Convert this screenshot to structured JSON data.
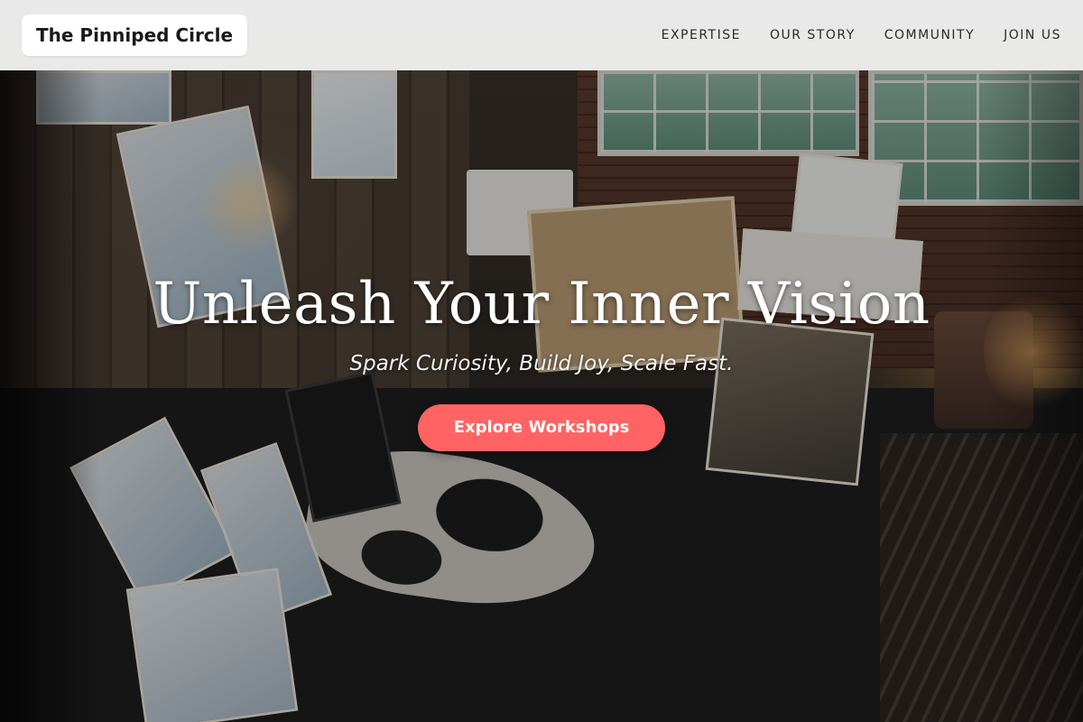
{
  "header": {
    "logo_text": "The Pinniped Circle",
    "nav": [
      {
        "label": "EXPERTISE"
      },
      {
        "label": "OUR STORY"
      },
      {
        "label": "COMMUNITY"
      },
      {
        "label": "JOIN US"
      }
    ]
  },
  "hero": {
    "title": "Unleash Your Inner Vision",
    "subtitle": "Spark Curiosity, Build Joy, Scale Fast.",
    "cta_label": "Explore Workshops",
    "background_image": "art-studio-photo"
  },
  "colors": {
    "cta_background": "#ff6363",
    "header_background": "#f0f0f0",
    "hero_text": "#ffffff"
  }
}
